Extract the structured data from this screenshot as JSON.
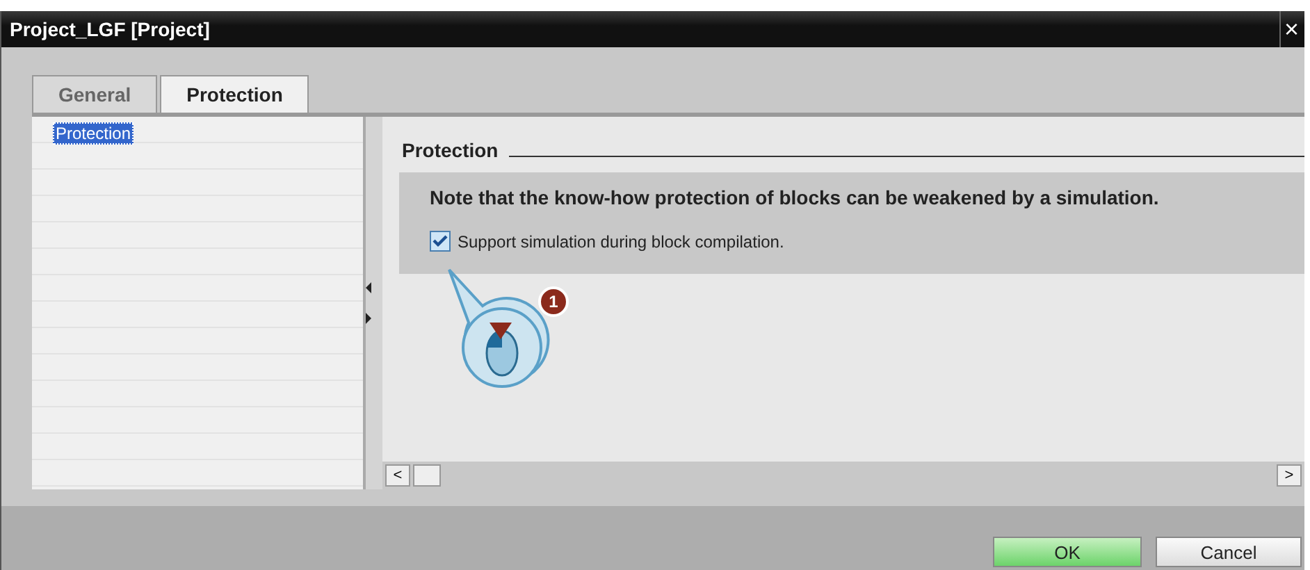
{
  "window": {
    "title": "Project_LGF [Project]",
    "close": "×"
  },
  "tabs": [
    {
      "label": "General",
      "selected": false
    },
    {
      "label": "Protection",
      "selected": true
    }
  ],
  "nav": {
    "items": [
      {
        "label": "Protection",
        "selected": true
      }
    ]
  },
  "section": {
    "title": "Protection",
    "note": "Note that the know-how protection of blocks can be weakened by a simulation.",
    "option": {
      "label": "Support simulation during block compilation.",
      "checked": true
    }
  },
  "callout": {
    "step": "1"
  },
  "scrollbar": {
    "left": "<",
    "right": ">"
  },
  "buttons": [
    {
      "label": "OK",
      "kind": "primary"
    },
    {
      "label": "Cancel",
      "kind": "secondary"
    }
  ]
}
